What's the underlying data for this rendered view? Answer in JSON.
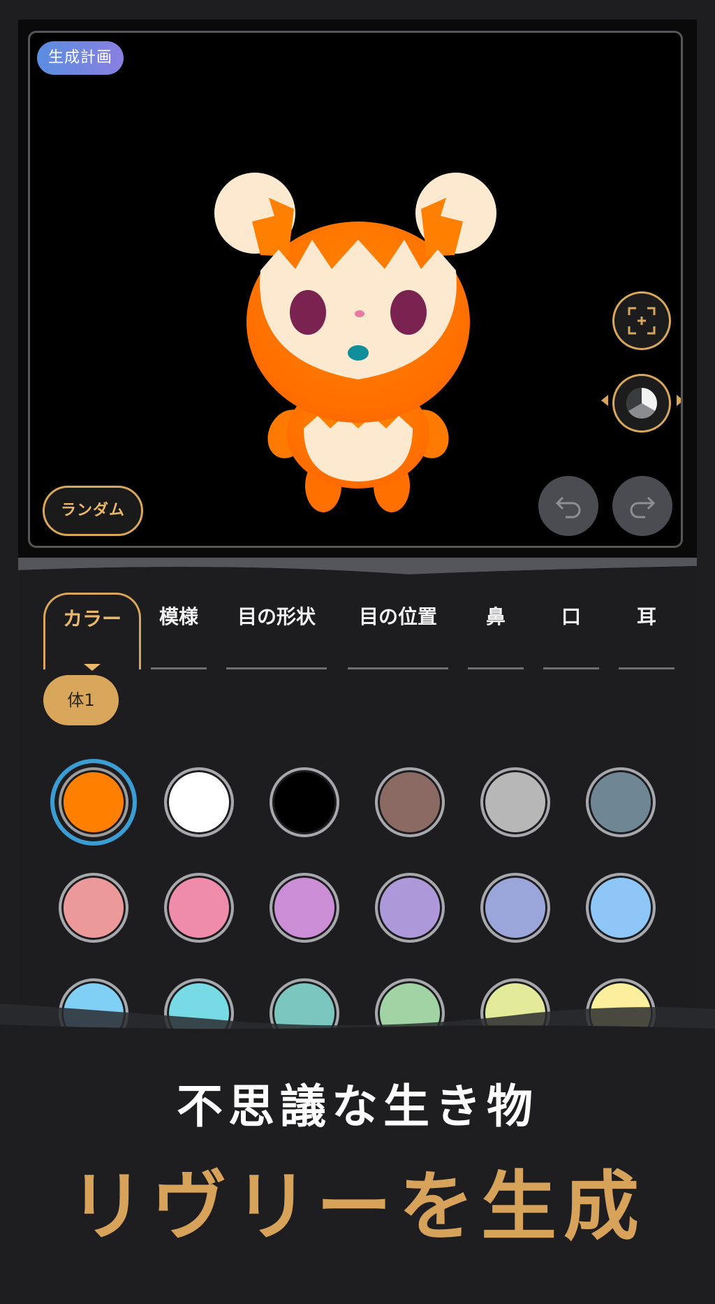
{
  "preview": {
    "plan_badge": "生成計画",
    "random_label": "ランダム",
    "icons": {
      "focus": "focus-frame-icon",
      "rotate": "pie-rotate-icon",
      "undo": "undo-icon",
      "redo": "redo-icon"
    }
  },
  "tabs": [
    {
      "label": "カラー",
      "active": true
    },
    {
      "label": "模様",
      "active": false
    },
    {
      "label": "目の形状",
      "active": false
    },
    {
      "label": "目の位置",
      "active": false
    },
    {
      "label": "鼻",
      "active": false
    },
    {
      "label": "口",
      "active": false
    },
    {
      "label": "耳",
      "active": false
    }
  ],
  "part_chip": "体1",
  "swatches": [
    "#ff8000",
    "#ffffff",
    "#000000",
    "#8a6a62",
    "#b7b7b7",
    "#6f8794",
    "#eb9a99",
    "#f08cab",
    "#cb8ed6",
    "#ad99d9",
    "#9aa6da",
    "#8fc6f8",
    "#80cff5",
    "#78dae5",
    "#7cc6c0",
    "#a2d3a4",
    "#e3ea9a",
    "#fbef9e"
  ],
  "selected_swatch_index": 0,
  "promo": {
    "subtitle": "不思議な生き物",
    "title": "リヴリーを生成"
  },
  "colors": {
    "accent": "#d9a75c",
    "creature_body": "#ff8000",
    "creature_cream": "#fde9cf",
    "creature_eye": "#7a2350"
  }
}
